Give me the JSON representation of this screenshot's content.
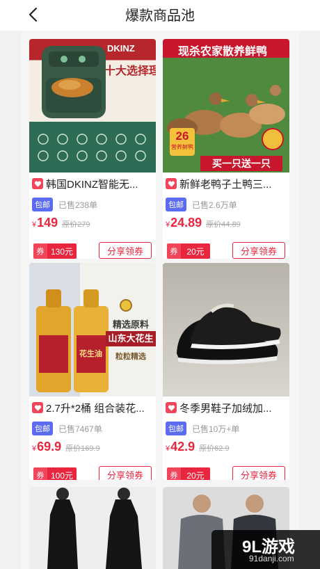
{
  "header": {
    "title": "爆款商品池"
  },
  "products": [
    {
      "image_caption": "十大选择理由",
      "image_brand": "DKINZ",
      "name": "韩国DKINZ智能无...",
      "shipping": "包邮",
      "sold": "已售238单",
      "currency": "¥",
      "price": "149",
      "original_price": "原价279",
      "coupon_label": "券",
      "coupon_amount": "130元",
      "share_label": "分享领券"
    },
    {
      "image_caption": "现杀农家散养鲜鸭",
      "image_badge_num": "26",
      "image_badge_sub": "营养鲜鸭",
      "image_ribbon": "买一只送一只",
      "name": "新鲜老鸭子土鸭三...",
      "shipping": "包邮",
      "sold": "已售2.6万单",
      "currency": "¥",
      "price": "24.89",
      "original_price": "原价44.89",
      "coupon_label": "券",
      "coupon_amount": "20元",
      "share_label": "分享领券"
    },
    {
      "image_caption_1": "精选原料",
      "image_caption_2": "山东大花生",
      "image_caption_3": "粒粒精选",
      "image_bottle_label": "花生油",
      "name": "2.7升*2桶 组合装花...",
      "shipping": "包邮",
      "sold": "已售7467单",
      "currency": "¥",
      "price": "69.9",
      "original_price": "原价169.9",
      "coupon_label": "券",
      "coupon_amount": "100元",
      "share_label": "分享领券"
    },
    {
      "name": "冬季男鞋子加绒加...",
      "shipping": "包邮",
      "sold": "已售10万+单",
      "currency": "¥",
      "price": "42.9",
      "original_price": "原价62.9",
      "coupon_label": "券",
      "coupon_amount": "20元",
      "share_label": "分享领券"
    }
  ],
  "watermark": {
    "logo": "9L游戏",
    "url": "91danji.com"
  },
  "colors": {
    "accent": "#e8263e",
    "badge_blue": "#5b6cf0",
    "page_bg": "#f2f2f2"
  }
}
